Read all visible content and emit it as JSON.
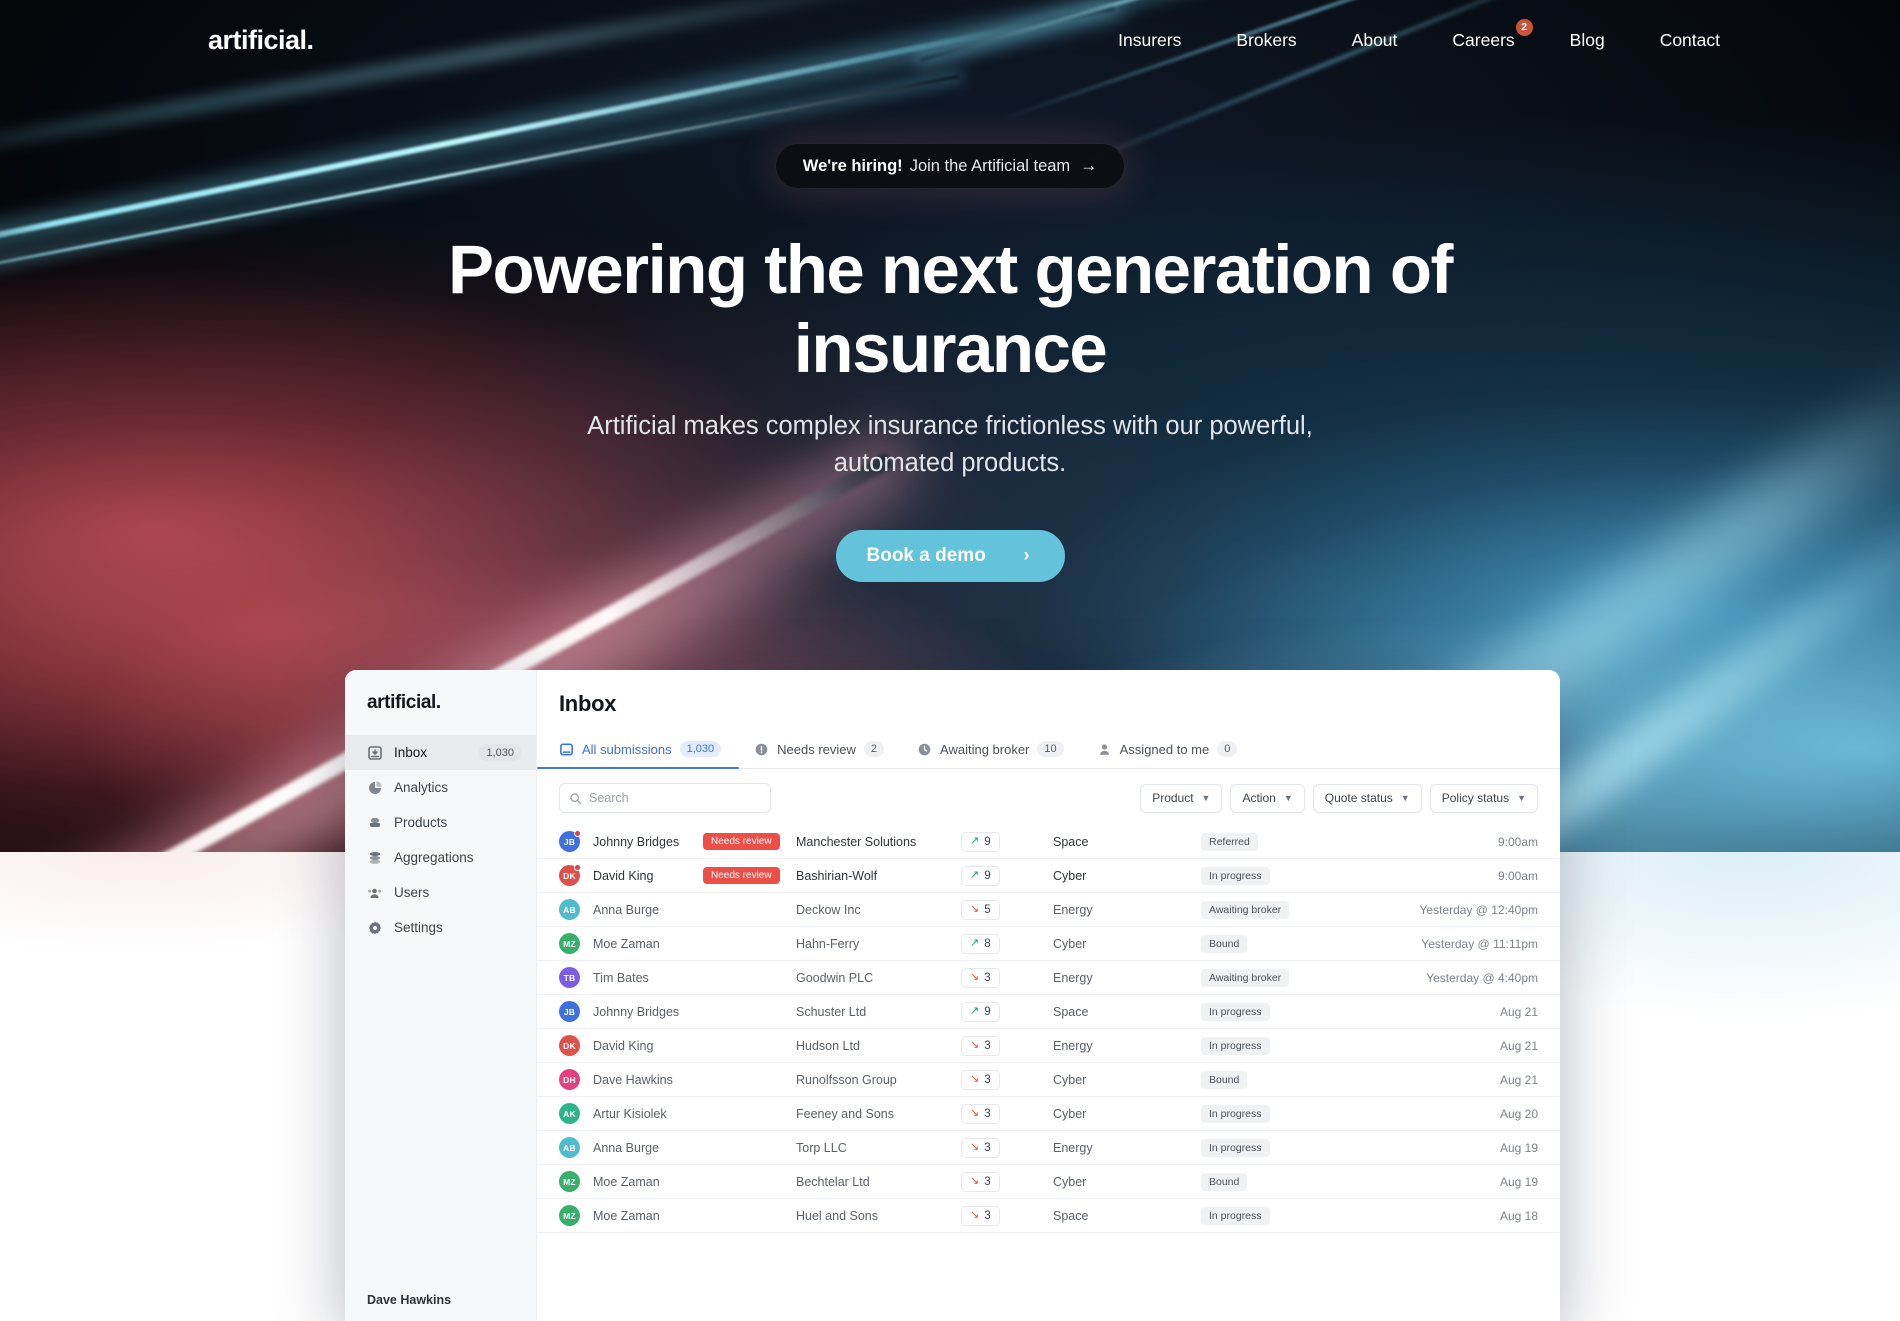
{
  "brand": "artificial.",
  "nav": {
    "items": [
      {
        "label": "Insurers",
        "badge": null
      },
      {
        "label": "Brokers",
        "badge": null
      },
      {
        "label": "About",
        "badge": null
      },
      {
        "label": "Careers",
        "badge": "2"
      },
      {
        "label": "Blog",
        "badge": null
      },
      {
        "label": "Contact",
        "badge": null
      }
    ]
  },
  "hero": {
    "pill_strong": "We're hiring!",
    "pill_rest": "Join the Artificial team",
    "pill_arrow": "→",
    "title": "Powering the next generation of insurance",
    "subtitle": "Artificial makes complex insurance frictionless with our powerful, automated products.",
    "cta_label": "Book a demo",
    "cta_chevron": "›",
    "cta_color": "#62c3da"
  },
  "app": {
    "brand": "artificial.",
    "sidebar": {
      "items": [
        {
          "label": "Inbox",
          "icon": "inbox-icon",
          "count": "1,030",
          "active": true
        },
        {
          "label": "Analytics",
          "icon": "analytics-icon",
          "count": null,
          "active": false
        },
        {
          "label": "Products",
          "icon": "products-icon",
          "count": null,
          "active": false
        },
        {
          "label": "Aggregations",
          "icon": "aggregations-icon",
          "count": null,
          "active": false
        },
        {
          "label": "Users",
          "icon": "users-icon",
          "count": null,
          "active": false
        },
        {
          "label": "Settings",
          "icon": "settings-icon",
          "count": null,
          "active": false
        }
      ],
      "user": "Dave Hawkins"
    },
    "page_title": "Inbox",
    "tabs": [
      {
        "label": "All submissions",
        "count": "1,030",
        "icon": "inbox-tab-icon",
        "active": true
      },
      {
        "label": "Needs review",
        "count": "2",
        "icon": "alert-icon",
        "active": false
      },
      {
        "label": "Awaiting broker",
        "count": "10",
        "icon": "clock-icon",
        "active": false
      },
      {
        "label": "Assigned to me",
        "count": "0",
        "icon": "person-icon",
        "active": false
      }
    ],
    "search_placeholder": "Search",
    "search_value": "",
    "filters": [
      {
        "label": "Product"
      },
      {
        "label": "Action"
      },
      {
        "label": "Quote status"
      },
      {
        "label": "Policy status"
      }
    ],
    "rows": [
      {
        "initials": "JB",
        "color": "#3f6fe0",
        "dot": true,
        "name": "Johnny Bridges",
        "flag": "Needs review",
        "company": "Manchester Solutions",
        "score": "9",
        "trend": "up",
        "product": "Space",
        "status": "Referred",
        "time": "9:00am"
      },
      {
        "initials": "DK",
        "color": "#e0504a",
        "dot": true,
        "name": "David King",
        "flag": "Needs review",
        "company": "Bashirian-Wolf",
        "score": "9",
        "trend": "up",
        "product": "Cyber",
        "status": "In progress",
        "time": "9:00am"
      },
      {
        "initials": "AB",
        "color": "#4ebccd",
        "dot": false,
        "name": "Anna Burge",
        "flag": null,
        "company": "Deckow Inc",
        "score": "5",
        "trend": "down",
        "product": "Energy",
        "status": "Awaiting broker",
        "time": "Yesterday @ 12:40pm"
      },
      {
        "initials": "MZ",
        "color": "#36b06a",
        "dot": false,
        "name": "Moe Zaman",
        "flag": null,
        "company": "Hahn-Ferry",
        "score": "8",
        "trend": "up",
        "product": "Cyber",
        "status": "Bound",
        "time": "Yesterday @ 11:11pm"
      },
      {
        "initials": "TB",
        "color": "#7c5ce6",
        "dot": false,
        "name": "Tim Bates",
        "flag": null,
        "company": "Goodwin PLC",
        "score": "3",
        "trend": "down",
        "product": "Energy",
        "status": "Awaiting broker",
        "time": "Yesterday @ 4:40pm"
      },
      {
        "initials": "JB",
        "color": "#3f6fe0",
        "dot": false,
        "name": "Johnny Bridges",
        "flag": null,
        "company": "Schuster Ltd",
        "score": "9",
        "trend": "up",
        "product": "Space",
        "status": "In progress",
        "time": "Aug 21"
      },
      {
        "initials": "DK",
        "color": "#e0504a",
        "dot": false,
        "name": "David King",
        "flag": null,
        "company": "Hudson Ltd",
        "score": "3",
        "trend": "down",
        "product": "Energy",
        "status": "In progress",
        "time": "Aug 21"
      },
      {
        "initials": "DH",
        "color": "#e2407f",
        "dot": false,
        "name": "Dave Hawkins",
        "flag": null,
        "company": "Runolfsson Group",
        "score": "3",
        "trend": "down",
        "product": "Cyber",
        "status": "Bound",
        "time": "Aug 21"
      },
      {
        "initials": "AK",
        "color": "#2fb489",
        "dot": false,
        "name": "Artur Kisiolek",
        "flag": null,
        "company": "Feeney and Sons",
        "score": "3",
        "trend": "down",
        "product": "Cyber",
        "status": "In progress",
        "time": "Aug 20"
      },
      {
        "initials": "AB",
        "color": "#4ebccd",
        "dot": false,
        "name": "Anna Burge",
        "flag": null,
        "company": "Torp LLC",
        "score": "3",
        "trend": "down",
        "product": "Energy",
        "status": "In progress",
        "time": "Aug 19"
      },
      {
        "initials": "MZ",
        "color": "#36b06a",
        "dot": false,
        "name": "Moe Zaman",
        "flag": null,
        "company": "Bechtelar Ltd",
        "score": "3",
        "trend": "down",
        "product": "Cyber",
        "status": "Bound",
        "time": "Aug 19"
      },
      {
        "initials": "MZ",
        "color": "#36b06a",
        "dot": false,
        "name": "Moe Zaman",
        "flag": null,
        "company": "Huel and Sons",
        "score": "3",
        "trend": "down",
        "product": "Space",
        "status": "In progress",
        "time": "Aug 18"
      }
    ]
  }
}
